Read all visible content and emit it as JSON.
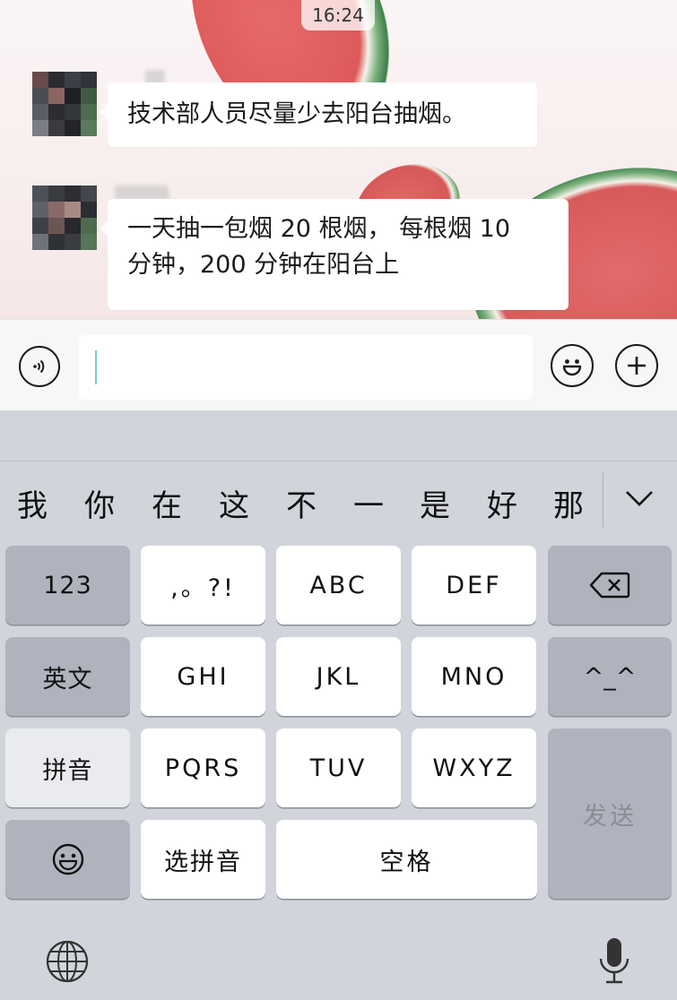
{
  "status": {
    "time": "16:24"
  },
  "chat": {
    "messages": [
      {
        "text": "技术部人员尽量少去阳台抽烟。"
      },
      {
        "line1": "一天抽一包烟 20 根烟， 每根烟 10",
        "line2": "分钟，200 分钟在阳台上"
      }
    ]
  },
  "input": {
    "value": "",
    "voice_icon": "voice-icon",
    "emoji_icon": "emoji-icon",
    "add_icon": "plus-icon"
  },
  "keyboard": {
    "candidates": [
      "我",
      "你",
      "在",
      "这",
      "不",
      "一",
      "是",
      "好",
      "那"
    ],
    "keys": {
      "num": "123",
      "punct": ",。?!",
      "abc": "ABC",
      "def": "DEF",
      "en": "英文",
      "ghi": "GHI",
      "jkl": "JKL",
      "mno": "MNO",
      "kaomoji": "^_^",
      "pinyin": "拼音",
      "pqrs": "PQRS",
      "tuv": "TUV",
      "wxyz": "WXYZ",
      "send": "发送",
      "select_pinyin": "选拼音",
      "space": "空格"
    },
    "icons": [
      "delete-icon",
      "emoji-icon",
      "globe-icon",
      "microphone-icon",
      "chevron-down-icon"
    ]
  }
}
